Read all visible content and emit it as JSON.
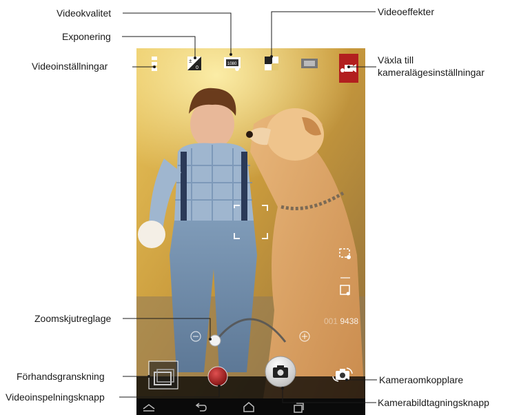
{
  "labels": {
    "videokvalitet": "Videokvalitet",
    "exponering": "Exponering",
    "videoinstallningar": "Videoinställningar",
    "videoeffekter": "Videoeffekter",
    "vaxla_line1": "Växla till",
    "vaxla_line2": "kameralägesinställningar",
    "zoomskjutreglage": "Zoomskjutreglage",
    "forhandsgranskning": "Förhandsgranskning",
    "videoinspelningsknapp": "Videoinspelningsknapp",
    "kameraomkopplare": "Kameraomkopplare",
    "kamerabildtagningsknapp": "Kamerabildtagningsknapp"
  },
  "screen": {
    "counter": "9438",
    "counter_faded": "001"
  },
  "colors": {
    "leader_line": "#1a1a1a",
    "mode_switch": "#b21f1f",
    "record_button": "#a01616",
    "shutter_button": "#d8d8d8"
  },
  "icons": [
    "settings-icon",
    "exposure-icon",
    "video-quality-icon",
    "video-effects-icon",
    "film-icon",
    "camera-mode-switch-icon",
    "zoom-minus-icon",
    "zoom-plus-icon",
    "zoom-slider-knob",
    "preview-thumbnail-icon",
    "record-button",
    "camera-shutter-icon",
    "camera-switch-icon",
    "home-icon",
    "back-icon",
    "recent-apps-icon",
    "collapse-icon"
  ]
}
